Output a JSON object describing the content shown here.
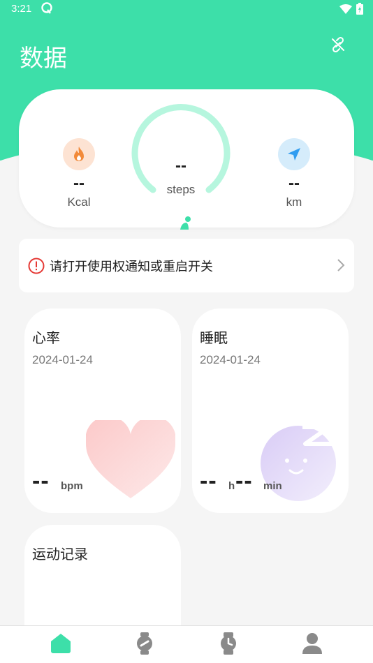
{
  "status_bar": {
    "time": "3:21"
  },
  "header": {
    "title": "数据"
  },
  "summary": {
    "calories": {
      "value": "--",
      "unit": "Kcal"
    },
    "steps": {
      "value": "--",
      "unit": "steps"
    },
    "distance": {
      "value": "--",
      "unit": "km"
    }
  },
  "notice": {
    "text": "请打开使用权通知或重启开关"
  },
  "heart_rate": {
    "title": "心率",
    "date": "2024-01-24",
    "value": "--",
    "unit": "bpm"
  },
  "sleep": {
    "title": "睡眠",
    "date": "2024-01-24",
    "hours": "--",
    "hours_unit": "h",
    "minutes": "--",
    "minutes_unit": "min"
  },
  "exercise": {
    "title": "运动记录"
  },
  "nav": {
    "items": [
      {
        "name": "home-icon",
        "active": true
      },
      {
        "name": "watch-face-icon",
        "active": false
      },
      {
        "name": "watch-icon",
        "active": false
      },
      {
        "name": "profile-icon",
        "active": false
      }
    ]
  },
  "colors": {
    "accent": "#3ddfa9",
    "calorie": "#f28a3a",
    "distance": "#2f9cf0",
    "inactive_nav": "#8a8a8a"
  }
}
